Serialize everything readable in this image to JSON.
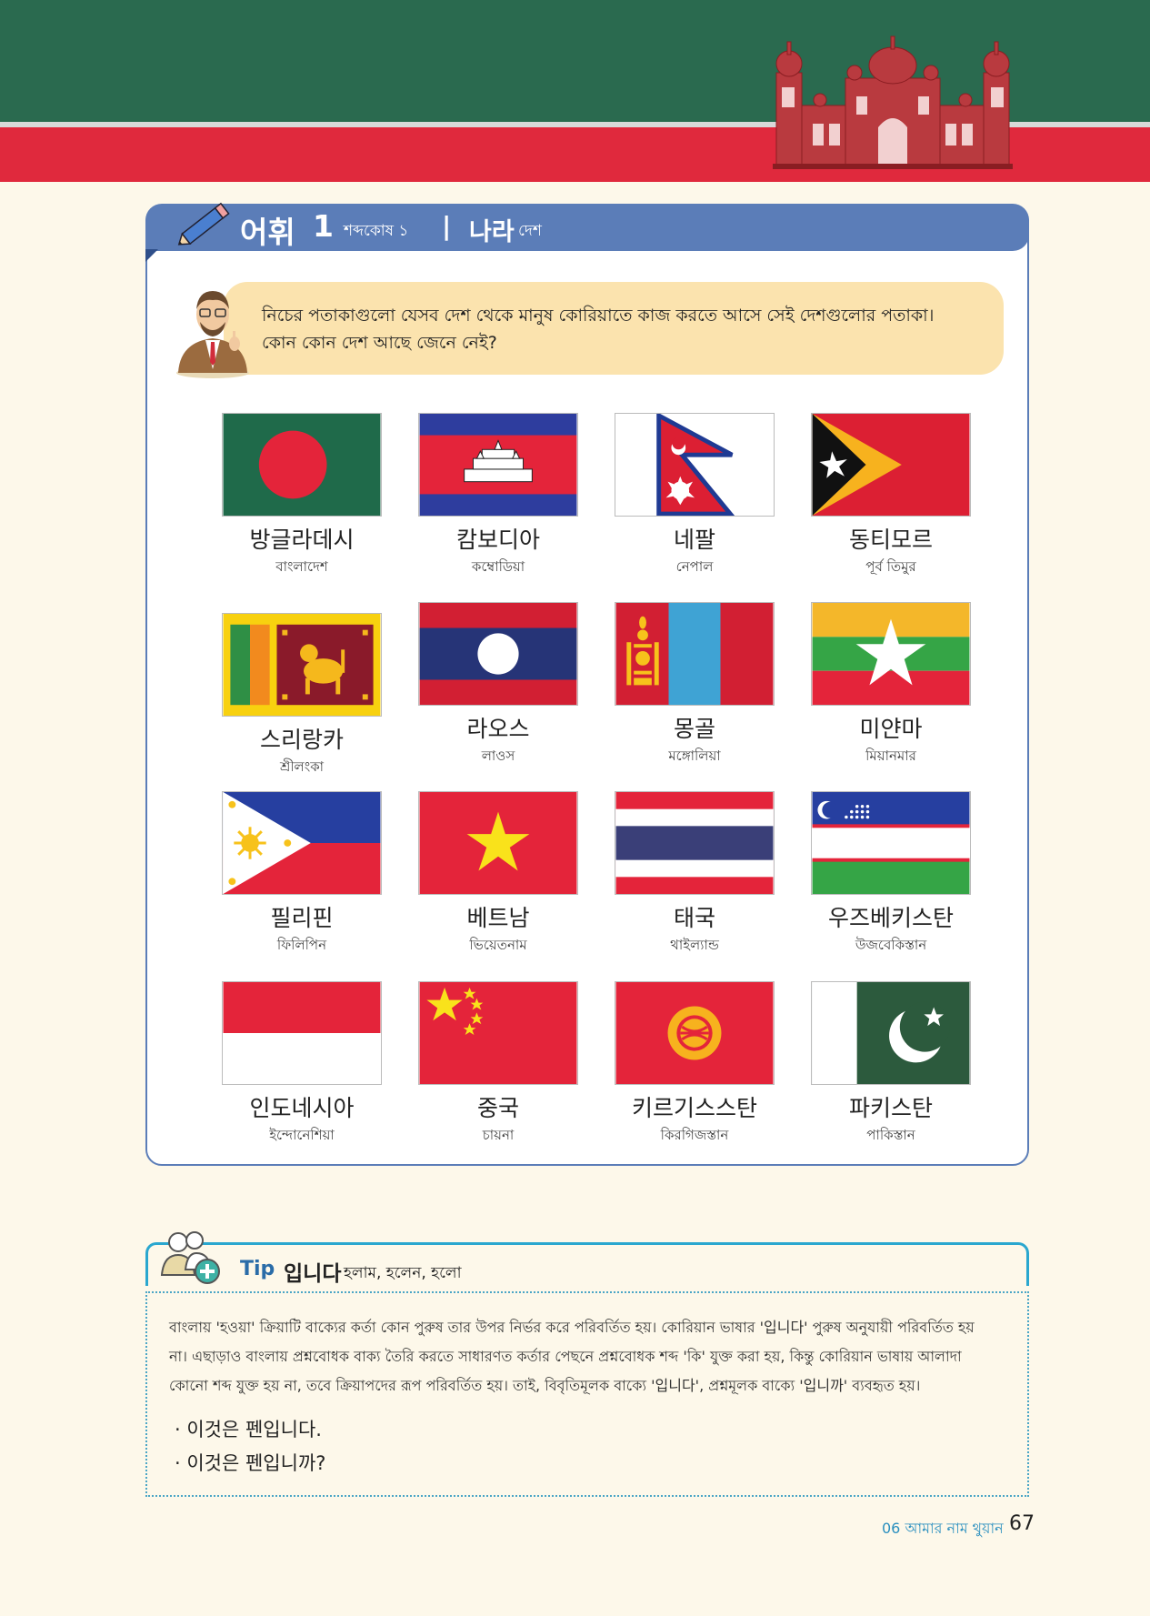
{
  "header": {
    "title": "어휘",
    "number": "1",
    "subtitle": "শব্দকোষ ১",
    "separator": "|",
    "topic": "나라",
    "topic_bn": "দেশ"
  },
  "intro": {
    "line1": "নিচের পতাকাগুলো যেসব দেশ থেকে মানুষ কোরিয়াতে কাজ করতে আসে সেই দেশগুলোর পতাকা।",
    "line2": "কোন কোন দেশ আছে জেনে নেই?"
  },
  "flags": [
    {
      "ko": "방글라데시",
      "bn": "বাংলাদেশ",
      "icon": "bangladesh-flag"
    },
    {
      "ko": "캄보디아",
      "bn": "কম্বোডিয়া",
      "icon": "cambodia-flag"
    },
    {
      "ko": "네팔",
      "bn": "নেপাল",
      "icon": "nepal-flag"
    },
    {
      "ko": "동티모르",
      "bn": "পূর্ব তিমুর",
      "icon": "east-timor-flag"
    },
    {
      "ko": "스리랑카",
      "bn": "শ্রীলংকা",
      "icon": "sri-lanka-flag"
    },
    {
      "ko": "라오스",
      "bn": "লাওস",
      "icon": "laos-flag"
    },
    {
      "ko": "몽골",
      "bn": "মঙ্গোলিয়া",
      "icon": "mongolia-flag"
    },
    {
      "ko": "미얀마",
      "bn": "মিয়ানমার",
      "icon": "myanmar-flag"
    },
    {
      "ko": "필리핀",
      "bn": "ফিলিপিন",
      "icon": "philippines-flag"
    },
    {
      "ko": "베트남",
      "bn": "ভিয়েতনাম",
      "icon": "vietnam-flag"
    },
    {
      "ko": "태국",
      "bn": "থাইল্যান্ড",
      "icon": "thailand-flag"
    },
    {
      "ko": "우즈베키스탄",
      "bn": "উজবেকিস্তান",
      "icon": "uzbekistan-flag"
    },
    {
      "ko": "인도네시아",
      "bn": "ইন্দোনেশিয়া",
      "icon": "indonesia-flag"
    },
    {
      "ko": "중국",
      "bn": "চায়না",
      "icon": "china-flag"
    },
    {
      "ko": "키르기스스탄",
      "bn": "কিরগিজস্তান",
      "icon": "kyrgyzstan-flag"
    },
    {
      "ko": "파키스탄",
      "bn": "পাকিস্তান",
      "icon": "pakistan-flag"
    }
  ],
  "tip": {
    "label": "Tip",
    "word": "입니다",
    "word_bn": "হলাম, হলেন, হলো",
    "line1": "বাংলায় 'হওয়া' ক্রিয়াটি বাক্যের কর্তা কোন পুরুষ তার উপর নির্ভর করে পরিবর্তিত হয়। কোরিয়ান ভাষার '입니다' পুরুষ অনুযায়ী পরিবর্তিত হয়",
    "line2": "না। এছাড়াও বাংলায় প্রশ্নবোধক বাক্য তৈরি করতে সাধারণত কর্তার পেছনে প্রশ্নবোধক শব্দ 'কি' যুক্ত করা হয়, কিন্তু কোরিয়ান ভাষায় আলাদা",
    "line3": "কোনো শব্দ যুক্ত হয় না, তবে ক্রিয়াপদের রূপ পরিবর্তিত হয়। তাই, বিবৃতিমূলক বাক্যে '입니다', প্রশ্নমূলক বাক্যে '입니까' ব্যবহৃত হয়।",
    "example1": "· 이것은 펜입니다.",
    "example2": "· 이것은 펜입니까?"
  },
  "footer": {
    "chapter": "06 আমার নাম থুয়ান",
    "page": "67"
  },
  "colors": {
    "banner_green": "#2a6a4f",
    "banner_red": "#e0293d",
    "header_blue": "#5b7db8",
    "tip_blue": "#2aa7cf"
  }
}
